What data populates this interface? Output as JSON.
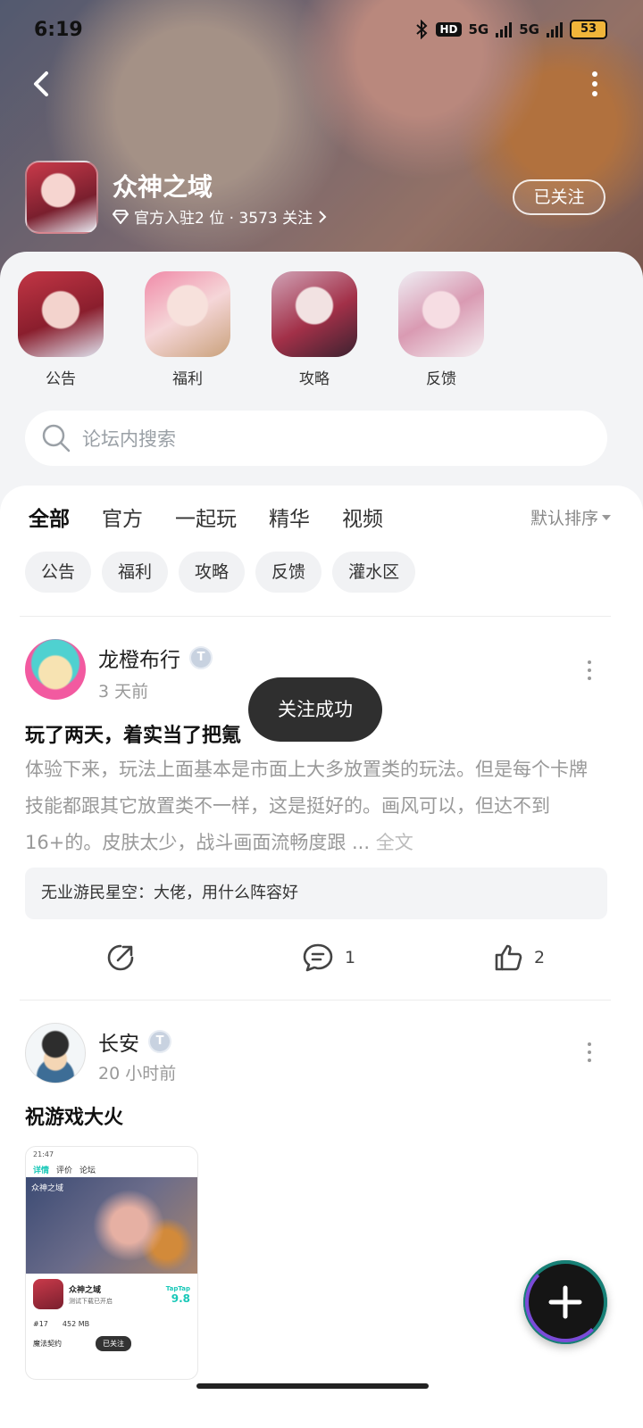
{
  "status_bar": {
    "time": "6:19",
    "hd": "HD",
    "net1": "5G",
    "net2": "5G",
    "battery": "53"
  },
  "header": {
    "app_name": "众神之域",
    "meta_text": "官方入驻2 位 · 3573 关注",
    "follow_label": "已关注"
  },
  "categories": [
    {
      "label": "公告"
    },
    {
      "label": "福利"
    },
    {
      "label": "攻略"
    },
    {
      "label": "反馈"
    }
  ],
  "search": {
    "placeholder": "论坛内搜索"
  },
  "tabs": [
    {
      "label": "全部",
      "active": true
    },
    {
      "label": "官方"
    },
    {
      "label": "一起玩"
    },
    {
      "label": "精华"
    },
    {
      "label": "视频"
    }
  ],
  "sort": {
    "label": "默认排序"
  },
  "chips": [
    {
      "label": "公告"
    },
    {
      "label": "福利"
    },
    {
      "label": "攻略"
    },
    {
      "label": "反馈"
    },
    {
      "label": "灌水区"
    }
  ],
  "posts": [
    {
      "user": "龙橙布行",
      "time": "3 天前",
      "title": "玩了两天，着实当了把氪",
      "body": "体验下来，玩法上面基本是市面上大多放置类的玩法。但是每个卡牌技能都跟其它放置类不一样，这是挺好的。画风可以，但达不到16+的。皮肤太少，战斗画面流畅度跟 ...",
      "full_text": "全文",
      "comment": "无业游民星空：大佬，用什么阵容好",
      "comments_count": "1",
      "likes_count": "2"
    },
    {
      "user": "长安",
      "time": "20 小时前",
      "title": "祝游戏大火",
      "screenshot": {
        "time": "21:47",
        "tab1": "详情",
        "tab2": "评价",
        "tab3": "论坛",
        "banner": "众神之域",
        "app_name": "众神之域",
        "sub": "测试下载已开启",
        "rating_brand": "TapTap",
        "score": "9.8",
        "rank": "#17",
        "size": "452 MB",
        "follow": "已关注",
        "tag": "魔法契约"
      }
    }
  ],
  "toast": {
    "text": "关注成功"
  },
  "colors": {
    "accent": "#19c8b8",
    "toast_bg": "#2f2f2f"
  }
}
